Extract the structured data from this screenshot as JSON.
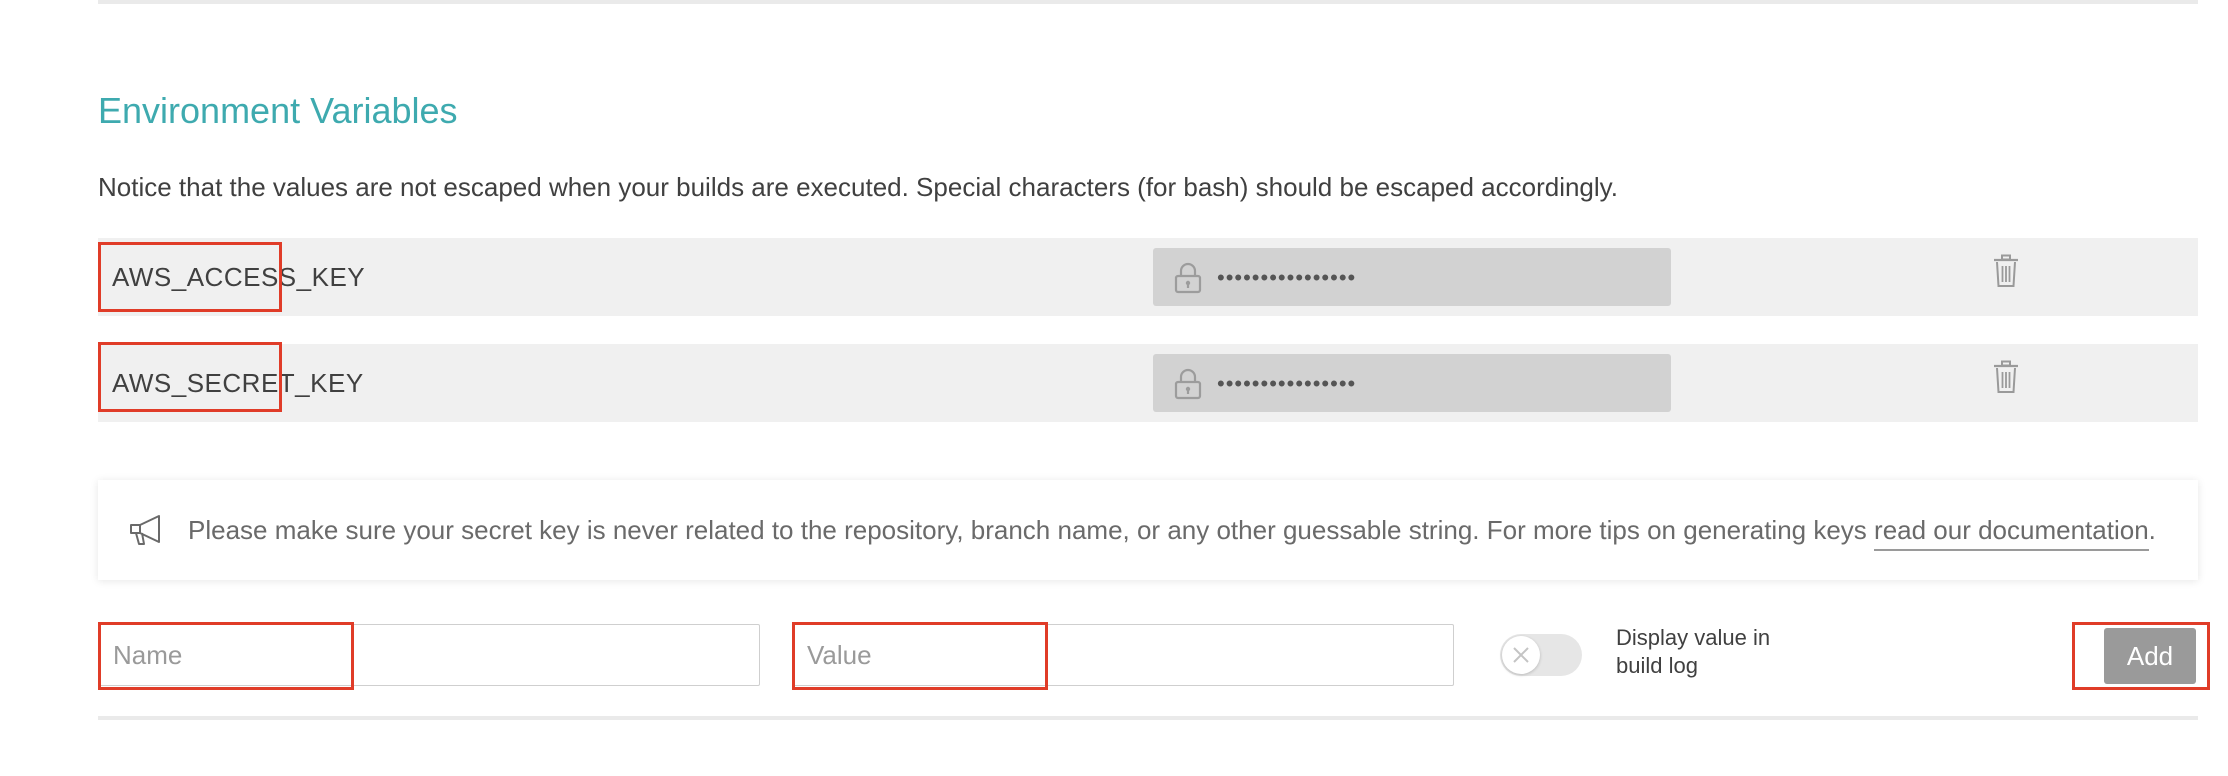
{
  "section": {
    "title": "Environment Variables",
    "notice": "Notice that the values are not escaped when your builds are executed. Special characters (for bash) should be escaped accordingly."
  },
  "variables": [
    {
      "name": "AWS_ACCESS_KEY",
      "value": "••••••••••••••••",
      "value_icon": "lock-icon",
      "delete_icon": "trash-icon"
    },
    {
      "name": "AWS_SECRET_KEY",
      "value": "••••••••••••••••",
      "value_icon": "lock-icon",
      "delete_icon": "trash-icon"
    }
  ],
  "tip": {
    "icon": "megaphone-icon",
    "text": "Please make sure your secret key is never related to the repository, branch name, or any other guessable string. For more tips on generating keys ",
    "link_text": "read our documentation",
    "suffix": "."
  },
  "form": {
    "name_placeholder": "Name",
    "value_placeholder": "Value",
    "display_toggle_label": "Display value in build log",
    "display_toggle_on": false,
    "add_label": "Add"
  },
  "colors": {
    "title": "#3eaaaf",
    "highlight": "#e03c28",
    "row_bg": "#f0f0f0",
    "value_bg": "#d2d2d2",
    "add_button": "#9a9a9a"
  }
}
